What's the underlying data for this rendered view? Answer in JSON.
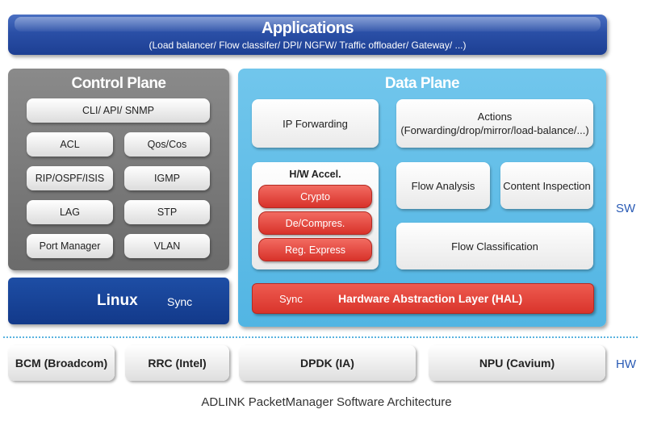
{
  "applications": {
    "title": "Applications",
    "subtitle": "(Load balancer/ Flow classifer/ DPI/ NGFW/ Traffic offloader/ Gateway/ ...)"
  },
  "control_plane": {
    "title": "Control Plane",
    "items": [
      "CLI/ API/ SNMP",
      "ACL",
      "Qos/Cos",
      "RIP/OSPF/ISIS",
      "IGMP",
      "LAG",
      "STP",
      "Port Manager",
      "VLAN"
    ]
  },
  "linux": {
    "label": "Linux",
    "sync": "Sync"
  },
  "data_plane": {
    "title": "Data Plane",
    "ip_forwarding": "IP Forwarding",
    "actions_title": "Actions",
    "actions_sub": "(Forwarding/drop/mirror/load-balance/...)",
    "hw_accel_title": "H/W Accel.",
    "hw_accel_items": [
      "Crypto",
      "De/Compres.",
      "Reg. Express"
    ],
    "flow_analysis": "Flow Analysis",
    "content_inspection": "Content Inspection",
    "flow_classification": "Flow Classification",
    "hal_sync": "Sync",
    "hal": "Hardware Abstraction Layer (HAL)"
  },
  "labels": {
    "sw": "SW",
    "hw": "HW"
  },
  "hardware": [
    "BCM (Broadcom)",
    "RRC (Intel)",
    "DPDK (IA)",
    "NPU (Cavium)"
  ],
  "caption": "ADLINK PacketManager Software Architecture",
  "colors": {
    "app_blue": "#2a4fa6",
    "control_gray": "#7a7a7a",
    "linux_blue": "#1a449a",
    "data_blue": "#5ebbe6",
    "accent_red": "#e0423a",
    "label_blue": "#2a5bb5"
  }
}
